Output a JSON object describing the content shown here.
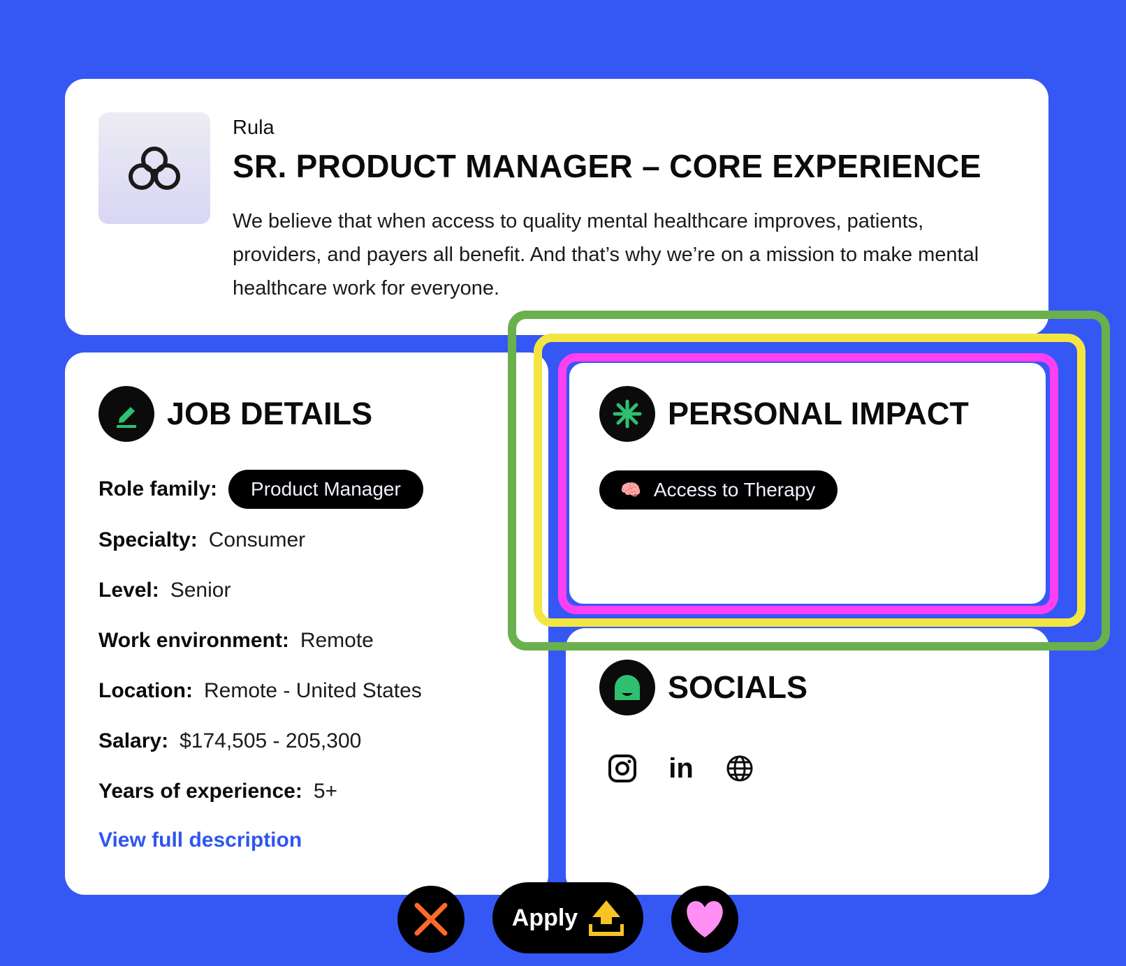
{
  "header": {
    "company": "Rula",
    "title": "SR. PRODUCT MANAGER – CORE EXPERIENCE",
    "mission": "We believe that when access to quality mental healthcare improves, patients, providers, and payers all benefit. And that’s why we’re on a mission to make mental healthcare work for everyone.",
    "logo_icon": "infinity-flower-icon"
  },
  "job_details": {
    "title": "JOB DETAILS",
    "icon": "pencil-icon",
    "role_family_label": "Role family:",
    "role_family_value": "Product Manager",
    "specialty_label": "Specialty:",
    "specialty_value": "Consumer",
    "level_label": "Level:",
    "level_value": "Senior",
    "work_env_label": "Work environment:",
    "work_env_value": "Remote",
    "location_label": "Location:",
    "location_value": "Remote - United States",
    "salary_label": "Salary:",
    "salary_value": "$174,505 - 205,300",
    "experience_label": "Years of experience:",
    "experience_value": "5+",
    "link": "View full description"
  },
  "personal_impact": {
    "title": "PERSONAL IMPACT",
    "icon": "asterisk-icon",
    "tag_emoji": "🧠",
    "tag_label": "Access to Therapy"
  },
  "socials": {
    "title": "SOCIALS",
    "icon": "chat-face-icon",
    "links": [
      "instagram-icon",
      "linkedin-icon",
      "globe-icon"
    ],
    "linkedin_text": "in"
  },
  "actions": {
    "apply_label": "Apply"
  },
  "colors": {
    "background": "#3558f5",
    "accent_green": "#2fbf71",
    "link_blue": "#2f55f0",
    "highlight_green": "#6ab04c",
    "highlight_yellow": "#f3e641",
    "highlight_pink": "#ff3ff4",
    "reject_orange": "#ff6a2a",
    "apply_yellow": "#f7c325",
    "like_pink": "#ff8ff5"
  }
}
